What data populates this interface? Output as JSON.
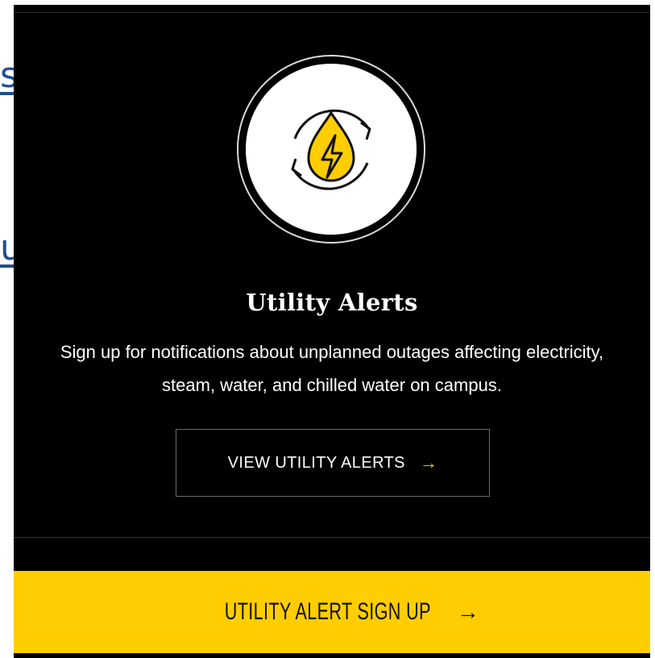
{
  "background_links": {
    "link_one_fragment": "s",
    "link_two_fragment": "u"
  },
  "card": {
    "icon": "utility-drop-lightning-cycle-icon",
    "title": "Utility Alerts",
    "description_line1": "Sign up for notifications about unplanned outages affecting electricity,",
    "description_line2": "steam, water, and chilled water on campus.",
    "view_button_label": "VIEW UTILITY ALERTS",
    "view_button_arrow": "→"
  },
  "signup_bar": {
    "label": "UTILITY ALERT SIGN UP",
    "arrow": "→"
  },
  "colors": {
    "panel_background": "#000000",
    "accent_gold": "#ffcd00",
    "link_blue": "#1f4f8f",
    "text_white": "#ffffff"
  }
}
